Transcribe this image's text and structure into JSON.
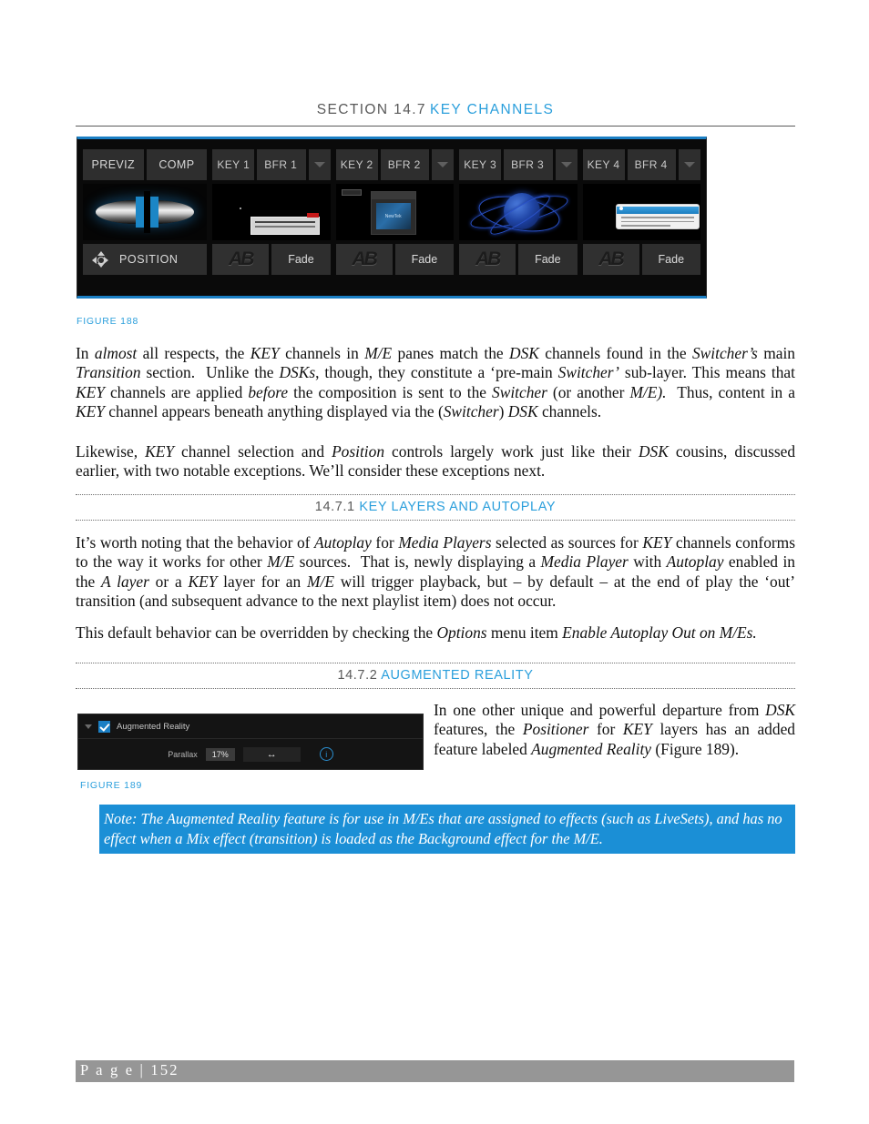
{
  "header": {
    "section_label": "SECTION 14.7",
    "section_title": "KEY CHANNELS"
  },
  "figure188": {
    "caption": "FIGURE 188",
    "previz_pane": {
      "buttons": [
        "PREVIZ",
        "COMP"
      ],
      "position_label": "POSITION",
      "position_icon": "move-crosshair-icon"
    },
    "key_panes": [
      {
        "key_label": "KEY 1",
        "bfr_label": "BFR 1",
        "transition_label": "Fade",
        "ab_icon": "ab-transition-icon",
        "caret_icon": "chevron-down-icon"
      },
      {
        "key_label": "KEY 2",
        "bfr_label": "BFR 2",
        "transition_label": "Fade",
        "ab_icon": "ab-transition-icon",
        "caret_icon": "chevron-down-icon"
      },
      {
        "key_label": "KEY 3",
        "bfr_label": "BFR 3",
        "transition_label": "Fade",
        "ab_icon": "ab-transition-icon",
        "caret_icon": "chevron-down-icon"
      },
      {
        "key_label": "KEY 4",
        "bfr_label": "BFR 4",
        "transition_label": "Fade",
        "ab_icon": "ab-transition-icon",
        "caret_icon": "chevron-down-icon"
      }
    ]
  },
  "body": {
    "p1_html": "In <i>almost</i> all respects, the <i>KEY</i> channels in <i>M/E</i> panes match the <i>DSK</i> channels found in the <i>Switcher&rsquo;s</i> main <i>Transition</i> section.&nbsp; Unlike the <i>DSKs</i>, though, they constitute a &lsquo;pre-main <i>Switcher&rsquo;</i> sub-layer. This means that <i>KEY</i> channels are applied <i>before</i> the composition is sent to the <i>Switcher</i> (or another <i>M/E).</i>&nbsp; Thus, content in a <i>KEY</i> channel appears beneath anything displayed via the (<i>Switcher</i>) <i>DSK</i> channels.",
    "p2_html": "Likewise<i>, KEY</i> channel selection and <i>Position</i> controls largely work just like their <i>DSK</i> cousins, discussed earlier, with two notable exceptions. We&rsquo;ll consider these exceptions next.",
    "p3_html": "It&rsquo;s worth noting that the behavior of <i>Autoplay</i> for <i>Media Players</i> selected as sources for <i>KEY</i> channels conforms to the way it works for other <i>M/E</i> sources.&nbsp; That is, newly displaying a <i>Media Player</i> with <i>Autoplay</i> enabled in the <i>A layer</i> or a <i>KEY</i> layer for an <i>M/E</i> will trigger playback, but &ndash; by default &ndash; at the end of play the &lsquo;out&rsquo; transition (and subsequent advance to the next playlist item) does not occur.",
    "p4_html": "This default behavior can be overridden by checking the <i>Options</i> menu item <i>Enable Autoplay Out on M/Es.</i>",
    "sidepara_html": "In one other unique and powerful departure from <i>DSK</i> features, the <i>Positioner</i> for <i>KEY</i> layers has an added feature labeled <i>Augmented Reality</i> (Figure 189)."
  },
  "subsections": [
    {
      "number": "14.7.1",
      "title": "KEY LAYERS AND AUTOPLAY"
    },
    {
      "number": "14.7.2",
      "title": "AUGMENTED REALITY"
    }
  ],
  "figure189": {
    "caption": "FIGURE 189",
    "panel": {
      "disclosure_icon": "chevron-down-icon",
      "checkbox_checked": true,
      "title": "Augmented Reality",
      "parallax_label": "Parallax",
      "parallax_value": "17%",
      "nudge_icon": "left-right-arrow-icon",
      "nudge_glyph": "↔",
      "info_icon": "info-circle-icon",
      "info_glyph": "i"
    }
  },
  "note": {
    "text": "Note: The Augmented Reality feature is for use in M/Es that are assigned to effects (such as LiveSets), and has no effect when a Mix effect (transition) is loaded as the Background effect for the M/E."
  },
  "footer": {
    "page_text": "P a g e  |  152"
  },
  "colors": {
    "accent_blue": "#2b9fdc",
    "note_blue": "#1b8fd6",
    "heading_gray": "#595959",
    "footer_gray": "#969696"
  }
}
